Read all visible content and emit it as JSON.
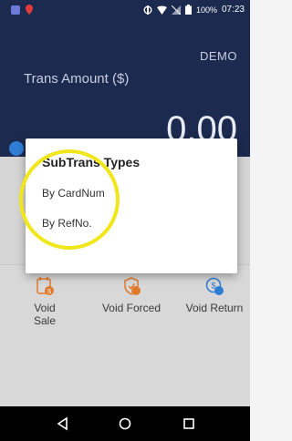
{
  "status_bar": {
    "battery": "100%",
    "time": "07:23"
  },
  "header": {
    "mode": "DEMO",
    "amount_label": "Trans Amount ($)",
    "amount_value": "0.00"
  },
  "dialog": {
    "title": "SubTrans Types",
    "items": [
      "By CardNum",
      "By RefNo."
    ]
  },
  "actions": [
    {
      "label": "Void Sale",
      "icon": "void-sale-icon"
    },
    {
      "label": "Void Forced",
      "icon": "void-forced-icon"
    },
    {
      "label": "Void Return",
      "icon": "void-return-icon"
    }
  ],
  "colors": {
    "header_bg": "#1b2a4e",
    "highlight": "#f0e61a",
    "icon_orange": "#e07a2b",
    "icon_blue": "#2f7dd4"
  },
  "navbar": {
    "icons": [
      "back-icon",
      "home-icon",
      "recents-icon"
    ]
  }
}
